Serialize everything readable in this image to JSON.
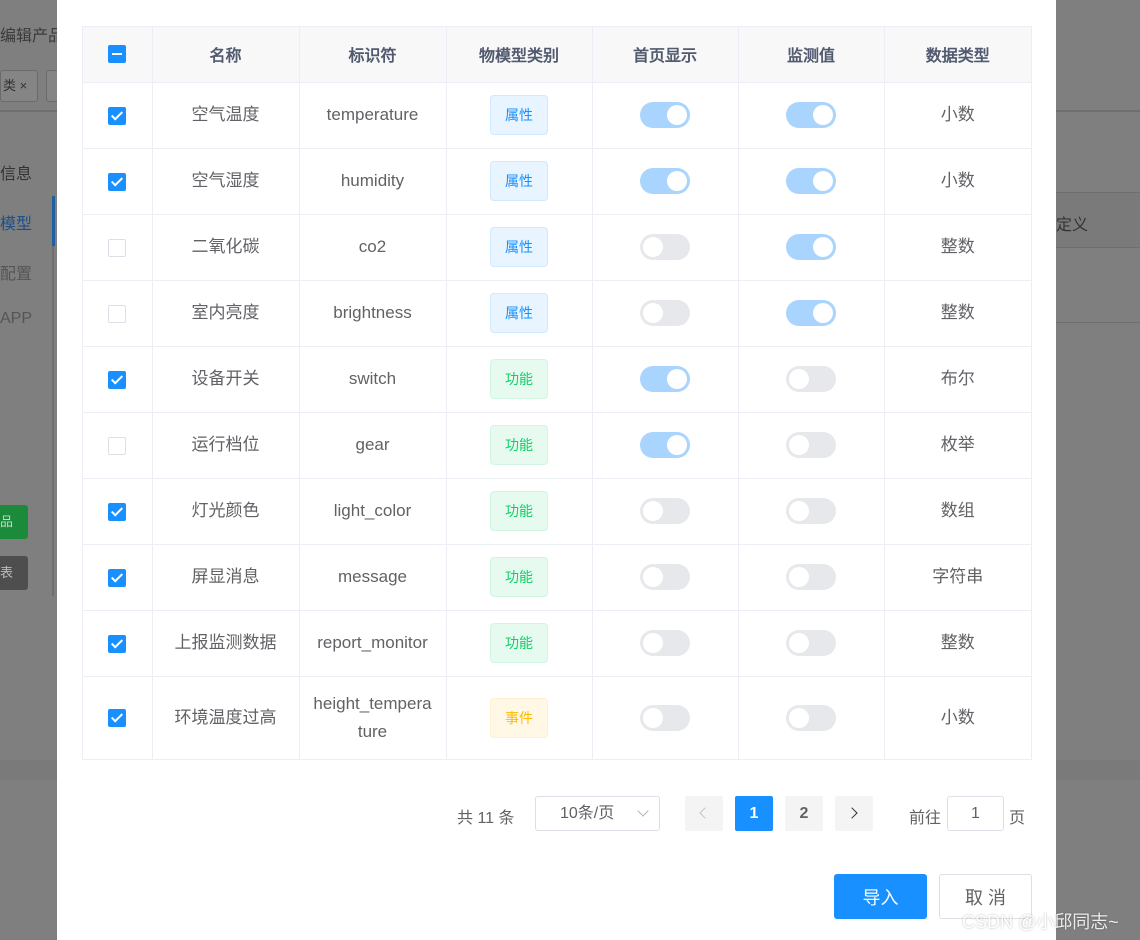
{
  "background": {
    "title_fragment": "编辑产品",
    "tag_fragment": "类 ×",
    "nav": [
      "信息",
      "模型",
      "配置",
      "APP"
    ],
    "btn_green": "品",
    "btn_gray": "表",
    "right_header": "定义"
  },
  "table": {
    "headers": [
      "名称",
      "标识符",
      "物模型类别",
      "首页显示",
      "监测值",
      "数据类型"
    ],
    "rows": [
      {
        "checked": true,
        "name": "空气温度",
        "id": "temperature",
        "type": "属性",
        "home": true,
        "monitor": true,
        "dtype": "小数"
      },
      {
        "checked": true,
        "name": "空气湿度",
        "id": "humidity",
        "type": "属性",
        "home": true,
        "monitor": true,
        "dtype": "小数"
      },
      {
        "checked": false,
        "name": "二氧化碳",
        "id": "co2",
        "type": "属性",
        "home": false,
        "monitor": true,
        "dtype": "整数"
      },
      {
        "checked": false,
        "name": "室内亮度",
        "id": "brightness",
        "type": "属性",
        "home": false,
        "monitor": true,
        "dtype": "整数"
      },
      {
        "checked": true,
        "name": "设备开关",
        "id": "switch",
        "type": "功能",
        "home": true,
        "monitor": false,
        "dtype": "布尔"
      },
      {
        "checked": false,
        "name": "运行档位",
        "id": "gear",
        "type": "功能",
        "home": true,
        "monitor": false,
        "dtype": "枚举"
      },
      {
        "checked": true,
        "name": "灯光颜色",
        "id": "light_color",
        "type": "功能",
        "home": false,
        "monitor": false,
        "dtype": "数组"
      },
      {
        "checked": true,
        "name": "屏显消息",
        "id": "message",
        "type": "功能",
        "home": false,
        "monitor": false,
        "dtype": "字符串"
      },
      {
        "checked": true,
        "name": "上报监测数据",
        "id": "report_monitor",
        "type": "功能",
        "home": false,
        "monitor": false,
        "dtype": "整数"
      },
      {
        "checked": true,
        "name": "环境温度过高",
        "id": "height_temperature",
        "type": "事件",
        "home": false,
        "monitor": false,
        "dtype": "小数"
      }
    ]
  },
  "pagination": {
    "total": "共 11 条",
    "page_size": "10条/页",
    "pages": [
      "1",
      "2"
    ],
    "current": "1",
    "goto_label": "前往",
    "goto_value": "1",
    "goto_suffix": "页"
  },
  "footer": {
    "confirm": "导入",
    "cancel": "取 消"
  },
  "watermark": "CSDN @小邱同志~",
  "colors": {
    "primary": "#1890ff",
    "tag_attr": "#1890ff",
    "tag_func": "#13ce66",
    "tag_event": "#ffba00",
    "switch_on": "#a8d4fd",
    "switch_off": "#e6e8ec"
  }
}
